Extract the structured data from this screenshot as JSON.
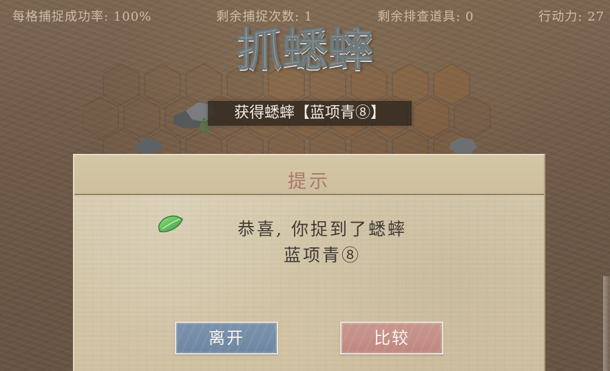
{
  "status": {
    "capture_rate": "每格捕捉成功率: 100%",
    "remaining_captures": "剩余捕捉次数: 1",
    "remaining_items": "剩余排查道具: 0",
    "action_points": "行动力: 27"
  },
  "game": {
    "title": "抓蟋蟀"
  },
  "banner": {
    "text": "获得蟋蟀【蓝项青⑧】"
  },
  "dialog": {
    "title": "提示",
    "message_line_1": "恭喜, 你捉到了蟋蟀",
    "message_line_2": "蓝项青⑧",
    "leaf_icon": "leaf-icon",
    "buttons": {
      "leave": "离开",
      "compare": "比较"
    }
  },
  "colors": {
    "status_text": "#cdbda7",
    "title_silver": "#8f9798",
    "dialog_title": "#aa7769",
    "leave_button": "#7c93ad",
    "compare_button": "#c9978f",
    "leaf_green": "#58b851"
  }
}
